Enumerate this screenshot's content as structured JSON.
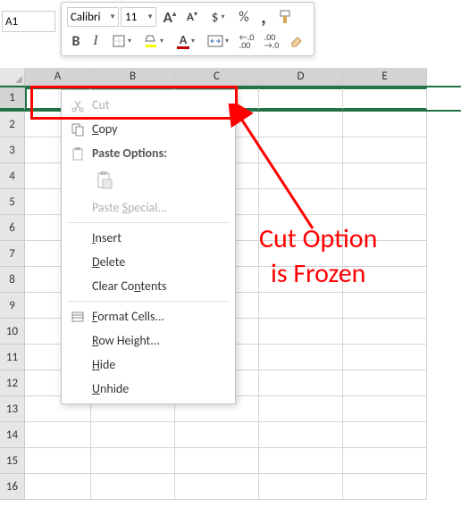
{
  "name_box": {
    "value": "A1"
  },
  "toolbar": {
    "font_name": "Calibri",
    "font_size": "11",
    "grow_font": "A",
    "shrink_font": "A",
    "currency": "$",
    "percent": "%",
    "comma": ",",
    "bold": "B",
    "italic": "I",
    "font_color_letter": "A",
    "inc_dec": ".0",
    "dec_dec": ".00"
  },
  "columns": [
    "A",
    "B",
    "C",
    "D",
    "E"
  ],
  "rows": [
    "1",
    "2",
    "3",
    "4",
    "5",
    "6",
    "7",
    "8",
    "9",
    "10",
    "11",
    "12",
    "13",
    "14",
    "15",
    "16"
  ],
  "context_menu": {
    "cut": "Cut",
    "copy": "Copy",
    "paste_options": "Paste Options:",
    "paste_special": "Paste Special...",
    "insert": "Insert",
    "delete": "Delete",
    "clear_contents": "Clear Contents",
    "format_cells": "Format Cells...",
    "row_height": "Row Height...",
    "hide": "Hide",
    "unhide": "Unhide"
  },
  "annotation": {
    "line1": "Cut Option",
    "line2": "is Frozen"
  }
}
